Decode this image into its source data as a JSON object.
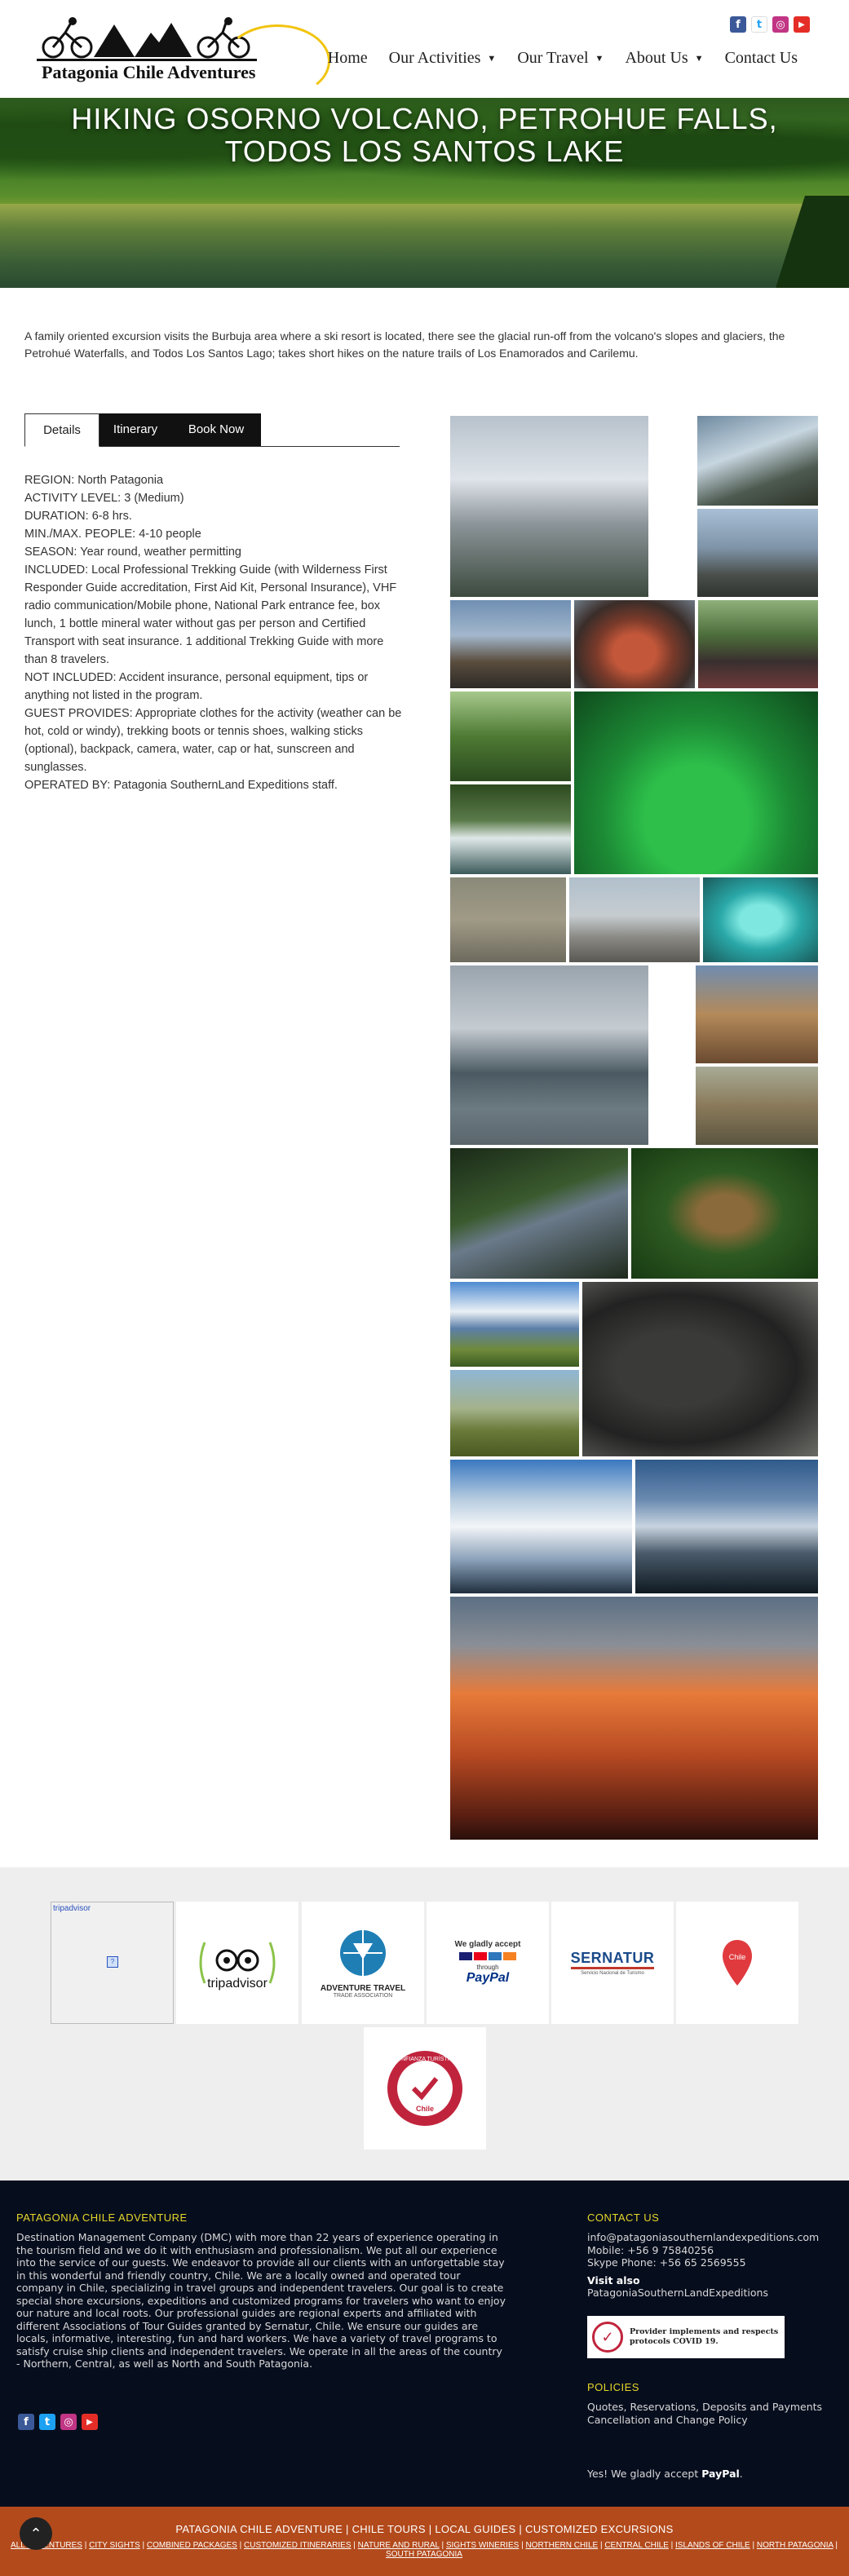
{
  "header": {
    "logo_text": "Patagonia Chile Adventures",
    "nav": [
      {
        "label": "Home",
        "has_menu": false
      },
      {
        "label": "Our Activities",
        "has_menu": true
      },
      {
        "label": "Our Travel",
        "has_menu": true
      },
      {
        "label": "About Us",
        "has_menu": true
      },
      {
        "label": "Contact Us",
        "has_menu": false
      }
    ],
    "social": [
      {
        "icon": "facebook-icon",
        "glyph": "f",
        "color": "#3b5998"
      },
      {
        "icon": "twitter-icon",
        "glyph": "t",
        "color": "#1da1f2"
      },
      {
        "icon": "instagram-icon",
        "glyph": "◎",
        "color": "#c13584"
      },
      {
        "icon": "youtube-icon",
        "glyph": "▶",
        "color": "#e52d27"
      }
    ]
  },
  "hero": {
    "title_line1": "HIKING OSORNO VOLCANO, PETROHUE FALLS,",
    "title_line2": "TODOS LOS SANTOS LAKE"
  },
  "intro": "A family oriented excursion visits the Burbuja area where a ski resort is located, there see the glacial run-off from the volcano's slopes and glaciers, the Petrohué Waterfalls, and Todos Los Santos Lago; takes short hikes on the nature trails of Los Enamorados and Carilemu.",
  "tabs": [
    "Details",
    "Itinerary",
    "Book Now"
  ],
  "details": [
    "REGION: North Patagonia",
    "ACTIVITY LEVEL: 3 (Medium)",
    "DURATION: 6-8 hrs.",
    "MIN./MAX. PEOPLE: 4-10 people",
    "SEASON: Year round, weather permitting",
    "INCLUDED: Local Professional Trekking Guide (with Wilderness First Responder Guide accreditation, First Aid Kit, Personal Insurance), VHF radio communication/Mobile phone, National Park entrance fee, box lunch, 1 bottle mineral water without gas per person and Certified Transport with seat insurance. 1 additional Trekking Guide with more than 8 travelers.",
    "NOT INCLUDED: Accident insurance, personal equipment, tips or anything not listed in the program.",
    "GUEST PROVIDES: Appropriate clothes for the activity (weather can be hot, cold or windy), trekking boots or tennis shoes, walking sticks (optional), backpack, camera, water, cap or hat, sunscreen and sunglasses.",
    "OPERATED BY: Patagonia SouthernLand Expeditions staff."
  ],
  "partners": {
    "tripadvisor_widget": "tripadvisor",
    "tripadvisor_logo": "tripadvisor",
    "ata_line1": "ADVENTURE TRAVEL",
    "ata_line2": "TRADE ASSOCIATION",
    "paypal_line1": "We gladly accept",
    "paypal_line2": "through",
    "paypal_brand": "PayPal",
    "sernatur_brand": "SERNATUR",
    "sernatur_sub": "Servicio Nacional de Turismo",
    "chile_brand": "Chile",
    "confianza_top": "CONFIANZA TURÍSTICA",
    "confianza_chile": "Chile"
  },
  "footer": {
    "about_heading": "PATAGONIA CHILE ADVENTURE",
    "about_text": "Destination Management Company (DMC) with more than 22 years of experience operating in the tourism field and we do it with enthusiasm and professionalism. We put all our experience into the service of our guests. We endeavor to provide all our clients with an unforgettable stay in this wonderful and friendly country, Chile. We are a locally owned and operated tour company in Chile, specializing in travel groups and independent travelers. Our goal is to create special shore excursions, expeditions and customized programs for travelers who want to enjoy our nature and local roots. Our professional guides are regional experts and affiliated with different Associations of Tour Guides granted by Sernatur, Chile. We ensure our guides are locals, informative, interesting, fun and hard workers. We have a variety of travel programs to satisfy cruise ship clients and independent travelers. We operate in all the areas of the country - Northern, Central, as well as North and South Patagonia.",
    "contact_heading": "CONTACT US",
    "email": "info@patagoniasouthernlandexpeditions.com",
    "mobile": "Mobile: +56 9 75840256",
    "skype": "Skype Phone: +56 65 2569555",
    "visit_label": "Visit also",
    "visit_site": "PatagoniaSouthernLandExpeditions",
    "covid_line1": "Provider implements and respects",
    "covid_line2": "protocols COVID 19.",
    "policies_heading": "POLICIES",
    "policy1": "Quotes, Reservations, Deposits and Payments",
    "policy2": "Cancellation and Change Policy",
    "paypal_text": "Yes! We gladly accept",
    "paypal_word": "PayPal",
    "paypal_dot": "."
  },
  "bottom_bar": {
    "line1": "PATAGONIA CHILE ADVENTURE | CHILE TOURS | LOCAL GUIDES | CUSTOMIZED EXCURSIONS",
    "links": [
      "ALL ADVENTURES",
      "CITY SIGHTS",
      "COMBINED PACKAGES",
      "CUSTOMIZED ITINERARIES",
      "NATURE AND RURAL",
      "SIGHTS WINERIES",
      "NORTHERN CHILE",
      "CENTRAL CHILE",
      "ISLANDS OF CHILE",
      "NORTH PATAGONIA",
      "SOUTH PATAGONIA"
    ],
    "top_button": "⌃"
  },
  "colors": {
    "footer_bg": "#060d1d",
    "footer_heading": "#e6d62a",
    "bottom_bar": "#b34a1c",
    "tab_dark": "#111111"
  }
}
